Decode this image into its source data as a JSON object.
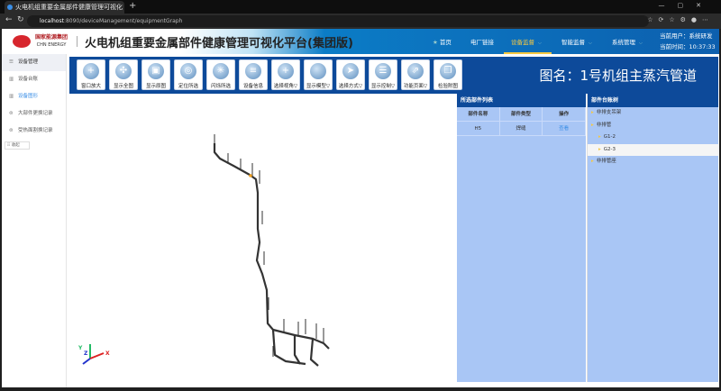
{
  "browser": {
    "tab_title": "火电机组重要金属部件健康管理可视化",
    "url_host": "localhost",
    "url_path": ":8090/deviceManagement/equipmentGraph"
  },
  "header": {
    "platform_title": "火电机组重要金属部件健康管理可视化平台(集团版)",
    "logo_cn": "国家能源集团",
    "logo_en": "CHN ENERGY",
    "menu": [
      {
        "label": "首页"
      },
      {
        "label": "电厂链接"
      },
      {
        "label": "设备监督"
      },
      {
        "label": "智能监督"
      },
      {
        "label": "系统管理"
      }
    ],
    "current_user": "当前用户：系统研发",
    "current_time": "当前时间：10:37:33"
  },
  "sidebar": {
    "items": [
      {
        "label": "设备管理"
      },
      {
        "label": "设备台账"
      },
      {
        "label": "设备图形"
      },
      {
        "label": "大部件更换记录"
      },
      {
        "label": "受热面割换记录"
      }
    ],
    "collapse": "收起"
  },
  "toolbar": {
    "buttons": [
      {
        "label": "窗口放大"
      },
      {
        "label": "显示全图"
      },
      {
        "label": "显示原图"
      },
      {
        "label": "定位所选"
      },
      {
        "label": "闪烁所选"
      },
      {
        "label": "设备信息"
      },
      {
        "label": "选择视角▽"
      },
      {
        "label": "显示模型▽"
      },
      {
        "label": "选择方式▽"
      },
      {
        "label": "显示控制▽"
      },
      {
        "label": "功能页面▽"
      },
      {
        "label": "检验附图"
      }
    ],
    "map_name": "图名：1号机组主蒸汽管道"
  },
  "selected_parts": {
    "title": "所选部件列表",
    "headers": [
      "部件名称",
      "部件类型",
      "操作"
    ],
    "rows": [
      [
        "H5",
        "焊缝",
        "查看"
      ]
    ]
  },
  "part_tree": {
    "title": "部件台账树",
    "nodes": [
      {
        "label": "非排支吊架",
        "level": 1
      },
      {
        "label": "非排管",
        "level": 1
      },
      {
        "label": "G1-2",
        "level": 2
      },
      {
        "label": "G2-3",
        "level": 2,
        "selected": true
      },
      {
        "label": "非排管座",
        "level": 1
      }
    ]
  },
  "axes": {
    "x": "X",
    "y": "Y",
    "z": "Z"
  }
}
